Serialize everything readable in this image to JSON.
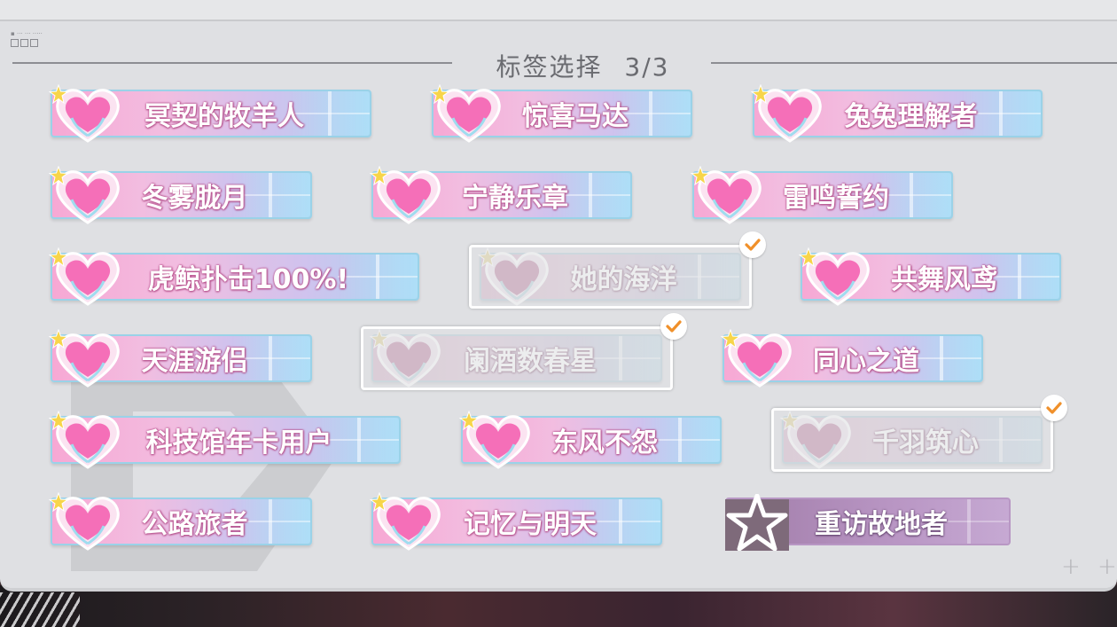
{
  "header": {
    "title": "标签选择",
    "counter": "3/3"
  },
  "tags": [
    {
      "label": "冥契的牧羊人",
      "selected": false
    },
    {
      "label": "惊喜马达",
      "selected": false
    },
    {
      "label": "兔兔理解者",
      "selected": false
    },
    {
      "label": "冬雾胧月",
      "selected": false
    },
    {
      "label": "宁静乐章",
      "selected": false
    },
    {
      "label": "雷鸣誓约",
      "selected": false
    },
    {
      "label": "虎鲸扑击100%!",
      "selected": false
    },
    {
      "label": "她的海洋",
      "selected": true
    },
    {
      "label": "共舞风鸢",
      "selected": false
    },
    {
      "label": "天涯游侣",
      "selected": false
    },
    {
      "label": "阑酒数春星",
      "selected": true
    },
    {
      "label": "同心之道",
      "selected": false
    },
    {
      "label": "科技馆年卡用户",
      "selected": false
    },
    {
      "label": "东风不怨",
      "selected": false
    },
    {
      "label": "千羽筑心",
      "selected": true
    },
    {
      "label": "公路旅者",
      "selected": false
    },
    {
      "label": "记忆与明天",
      "selected": false
    },
    {
      "label": "重访故地者",
      "selected": false,
      "style": "purple-star"
    }
  ],
  "icons": {
    "tag_icon": "heart-icon",
    "special_icon": "star-icon",
    "selected_icon": "checkmark-icon",
    "corner_icon": "plus-icon"
  },
  "colors": {
    "check": "#f0902a",
    "heart": "#f56fb8",
    "panel": "#dfe0e3"
  }
}
